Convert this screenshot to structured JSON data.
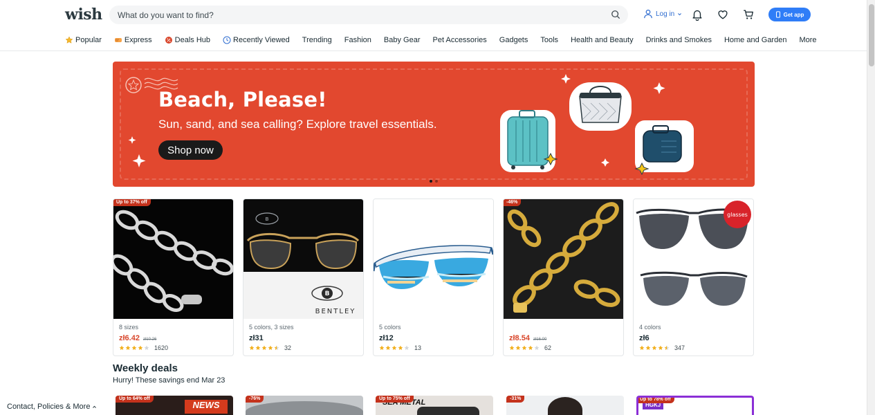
{
  "header": {
    "logo": "wish",
    "search_placeholder": "What do you want to find?",
    "login_label": "Log in",
    "get_app_label": "Get app"
  },
  "nav": [
    {
      "label": "Popular",
      "icon": "star-icon"
    },
    {
      "label": "Express",
      "icon": "express-icon"
    },
    {
      "label": "Deals Hub",
      "icon": "deals-icon"
    },
    {
      "label": "Recently Viewed",
      "icon": "clock-icon"
    },
    {
      "label": "Trending"
    },
    {
      "label": "Fashion"
    },
    {
      "label": "Baby Gear"
    },
    {
      "label": "Pet Accessories"
    },
    {
      "label": "Gadgets"
    },
    {
      "label": "Tools"
    },
    {
      "label": "Health and Beauty"
    },
    {
      "label": "Drinks and Smokes"
    },
    {
      "label": "Home and Garden"
    },
    {
      "label": "More"
    }
  ],
  "banner": {
    "title": "Beach, Please!",
    "subtitle": "Sun, sand, and sea calling? Explore travel essentials.",
    "cta": "Shop now",
    "accent": "#e2482f"
  },
  "products": [
    {
      "badge": "Up to 37% off",
      "meta": "8 sizes",
      "price": "zł6.42",
      "old_price": "zł10.26",
      "sale": true,
      "stars": 4,
      "reviews": "1620"
    },
    {
      "badge": "",
      "meta": "5 colors, 3 sizes",
      "price": "zł31",
      "old_price": "",
      "sale": false,
      "stars": 4.5,
      "reviews": "32",
      "brand": "BENTLEY"
    },
    {
      "badge": "",
      "meta": "5 colors",
      "price": "zł12",
      "old_price": "",
      "sale": false,
      "stars": 4,
      "reviews": "13"
    },
    {
      "badge": "-46%",
      "meta": "",
      "price": "zł8.54",
      "old_price": "zł16.00",
      "sale": true,
      "stars": 4,
      "reviews": "62"
    },
    {
      "badge": "",
      "meta": "4 colors",
      "price": "zł6",
      "old_price": "",
      "sale": false,
      "stars": 4.5,
      "reviews": "347",
      "tag": "glasses"
    }
  ],
  "weekly": {
    "title": "Weekly deals",
    "subtitle": "Hurry! These savings end Mar 23",
    "badges": [
      "Up to 64% off",
      "-76%",
      "Up to 75% off",
      "-31%",
      "Up to 78% off"
    ]
  },
  "footer": {
    "link": "Contact, Policies & More"
  }
}
